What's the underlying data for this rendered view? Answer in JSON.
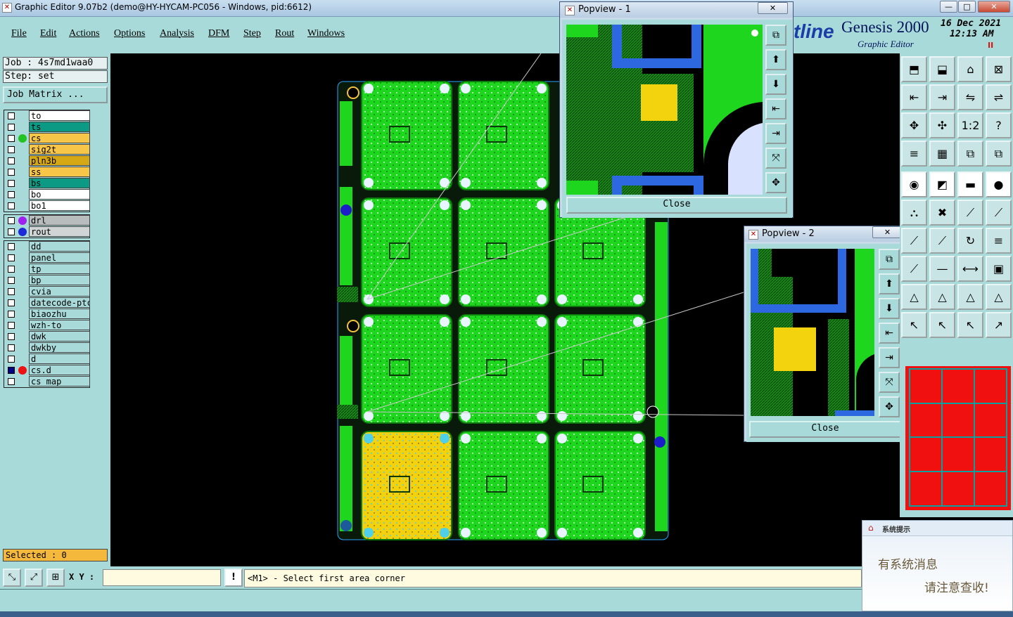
{
  "window": {
    "title": "Graphic Editor 9.07b2 (demo@HY-HYCAM-PC056 - Windows, pid:6612)",
    "min": "—",
    "max": "□",
    "close": "✕"
  },
  "menu": [
    "File",
    "Edit",
    "Actions",
    "Options",
    "Analysis",
    "DFM",
    "Step",
    "Rout",
    "Windows"
  ],
  "brand": {
    "logo": "tline",
    "product": "Genesis 2000",
    "sub": "Graphic Editor",
    "date": "16 Dec 2021",
    "time": "12:13 AM",
    "indicator": "II"
  },
  "job": {
    "job": "Job : 4s7md1waa0",
    "step": "Step: set",
    "matrix_button": "Job Matrix ..."
  },
  "layers_top": [
    {
      "name": "to",
      "bg": "#ffffff",
      "dot": ""
    },
    {
      "name": "ts",
      "bg": "#0d9a84",
      "dot": ""
    },
    {
      "name": "cs",
      "bg": "#f7c548",
      "dot": "#22c322"
    },
    {
      "name": "sig2t",
      "bg": "#f7c548",
      "dot": ""
    },
    {
      "name": "pln3b",
      "bg": "#d6a816",
      "dot": ""
    },
    {
      "name": "ss",
      "bg": "#f7c548",
      "dot": ""
    },
    {
      "name": "bs",
      "bg": "#0d9a84",
      "dot": ""
    },
    {
      "name": "bo",
      "bg": "#ffffff",
      "dot": ""
    },
    {
      "name": "bo1",
      "bg": "#ffffff",
      "dot": ""
    }
  ],
  "layers_drill": [
    {
      "name": "drl",
      "bg": "#b8bcbc",
      "dot": "#a020f0"
    },
    {
      "name": "rout",
      "bg": "#d0d4d4",
      "dot": "#1e2ad8"
    }
  ],
  "layers_misc": [
    {
      "name": "dd",
      "bg": "#a8dada",
      "dot": ""
    },
    {
      "name": "panel",
      "bg": "#a8dada",
      "dot": ""
    },
    {
      "name": "tp",
      "bg": "#a8dada",
      "dot": ""
    },
    {
      "name": "bp",
      "bg": "#a8dada",
      "dot": ""
    },
    {
      "name": "cvia",
      "bg": "#a8dada",
      "dot": ""
    },
    {
      "name": "datecode-ptc",
      "bg": "#a8dada",
      "dot": ""
    },
    {
      "name": "biaozhu",
      "bg": "#a8dada",
      "dot": ""
    },
    {
      "name": "wzh-to",
      "bg": "#a8dada",
      "dot": ""
    },
    {
      "name": "dwk",
      "bg": "#a8dada",
      "dot": ""
    },
    {
      "name": "dwkby",
      "bg": "#a8dada",
      "dot": ""
    },
    {
      "name": "d",
      "bg": "#a8dada",
      "dot": ""
    },
    {
      "name": "cs.d",
      "bg": "#a8dada",
      "dot": "#ee1111",
      "checked": true
    },
    {
      "name": "cs_map",
      "bg": "#a8dada",
      "dot": ""
    }
  ],
  "selected": "Selected : 0",
  "bottom": {
    "xy_label": "X Y :",
    "xy_value": "",
    "excl": "!",
    "prompt": "<M1> - Select first area corner"
  },
  "popview1": {
    "title": "Popview - 1",
    "close": "Close",
    "x": "✕"
  },
  "popview2": {
    "title": "Popview - 2",
    "close": "Close",
    "x": "✕"
  },
  "notify": {
    "header": "系统提示",
    "line1": "有系统消息",
    "line2": "请注意查收!"
  }
}
